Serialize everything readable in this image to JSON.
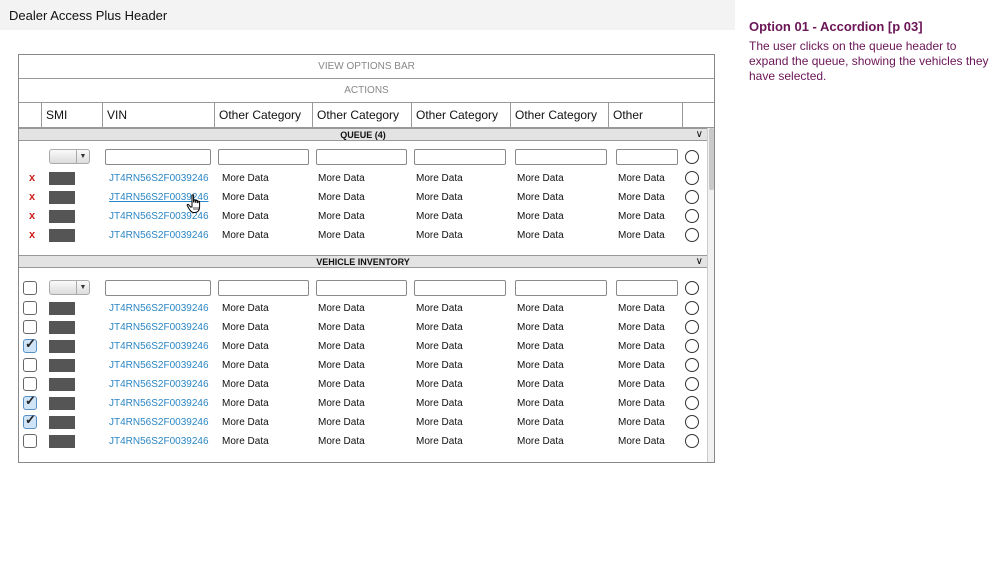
{
  "header": {
    "title": "Dealer Access Plus Header"
  },
  "annotation": {
    "title": "Option 01 - Accordion [p 03]",
    "body": "The user clicks on the queue header to expand the queue, showing the vehicles they have selected."
  },
  "view_options_bar": "VIEW OPTIONS BAR",
  "actions_bar": "ACTIONS",
  "columns": [
    "",
    "SMI",
    "VIN",
    "Other Category",
    "Other Category",
    "Other Category",
    "Other Category",
    "Other",
    ""
  ],
  "queue": {
    "title": "QUEUE (4)",
    "rows": [
      {
        "remove": "x",
        "vin": "JT4RN56S2F0039246",
        "c1": "More Data",
        "c2": "More Data",
        "c3": "More Data",
        "c4": "More Data",
        "c5": "More Data"
      },
      {
        "remove": "x",
        "vin": "JT4RN56S2F0039246",
        "c1": "More Data",
        "c2": "More Data",
        "c3": "More Data",
        "c4": "More Data",
        "c5": "More Data"
      },
      {
        "remove": "x",
        "vin": "JT4RN56S2F0039246",
        "c1": "More Data",
        "c2": "More Data",
        "c3": "More Data",
        "c4": "More Data",
        "c5": "More Data"
      },
      {
        "remove": "x",
        "vin": "JT4RN56S2F0039246",
        "c1": "More Data",
        "c2": "More Data",
        "c3": "More Data",
        "c4": "More Data",
        "c5": "More Data"
      }
    ]
  },
  "inventory": {
    "title": "VEHICLE INVENTORY",
    "rows": [
      {
        "checked": false,
        "vin": "JT4RN56S2F0039246",
        "c1": "More Data",
        "c2": "More Data",
        "c3": "More Data",
        "c4": "More Data",
        "c5": "More Data"
      },
      {
        "checked": false,
        "vin": "JT4RN56S2F0039246",
        "c1": "More Data",
        "c2": "More Data",
        "c3": "More Data",
        "c4": "More Data",
        "c5": "More Data"
      },
      {
        "checked": true,
        "vin": "JT4RN56S2F0039246",
        "c1": "More Data",
        "c2": "More Data",
        "c3": "More Data",
        "c4": "More Data",
        "c5": "More Data"
      },
      {
        "checked": false,
        "vin": "JT4RN56S2F0039246",
        "c1": "More Data",
        "c2": "More Data",
        "c3": "More Data",
        "c4": "More Data",
        "c5": "More Data"
      },
      {
        "checked": false,
        "vin": "JT4RN56S2F0039246",
        "c1": "More Data",
        "c2": "More Data",
        "c3": "More Data",
        "c4": "More Data",
        "c5": "More Data"
      },
      {
        "checked": true,
        "vin": "JT4RN56S2F0039246",
        "c1": "More Data",
        "c2": "More Data",
        "c3": "More Data",
        "c4": "More Data",
        "c5": "More Data"
      },
      {
        "checked": true,
        "vin": "JT4RN56S2F0039246",
        "c1": "More Data",
        "c2": "More Data",
        "c3": "More Data",
        "c4": "More Data",
        "c5": "More Data"
      },
      {
        "checked": false,
        "vin": "JT4RN56S2F0039246",
        "c1": "More Data",
        "c2": "More Data",
        "c3": "More Data",
        "c4": "More Data",
        "c5": "More Data"
      }
    ]
  },
  "colors": {
    "vin_link": "#2a86c4",
    "remove": "#d01e1e",
    "annotation": "#6b1556"
  },
  "icons": {
    "collapse": "chevron-down-icon",
    "cursor": "hand-pointer-icon",
    "remove": "remove-x-icon"
  }
}
